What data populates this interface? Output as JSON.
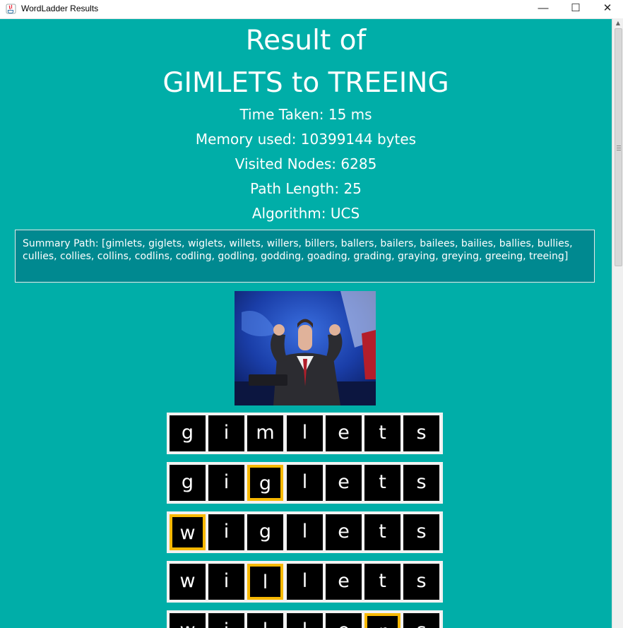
{
  "window": {
    "title": "WordLadder Results",
    "controls": {
      "minimize": "—",
      "maximize": "☐",
      "close": "✕"
    }
  },
  "result": {
    "heading_line1": "Result of",
    "heading_line2": "GIMLETS to TREEING",
    "time_taken": "Time Taken: 15 ms",
    "memory_used": "Memory used: 10399144 bytes",
    "visited_nodes": "Visited Nodes: 6285",
    "path_length": "Path Length: 25",
    "algorithm": "Algorithm: UCS",
    "summary_path": "Summary Path: [gimlets, giglets, wiglets, willets, willers, billers, ballers, bailers, bailees, bailies, ballies, bullies, cullies, collies, collins, codlins, codling, godling, godding, goading, grading, graying, greying, greeing, treeing]"
  },
  "ladder": [
    {
      "letters": [
        "g",
        "i",
        "m",
        "l",
        "e",
        "t",
        "s"
      ],
      "changed": -1
    },
    {
      "letters": [
        "g",
        "i",
        "g",
        "l",
        "e",
        "t",
        "s"
      ],
      "changed": 2
    },
    {
      "letters": [
        "w",
        "i",
        "g",
        "l",
        "e",
        "t",
        "s"
      ],
      "changed": 0
    },
    {
      "letters": [
        "w",
        "i",
        "l",
        "l",
        "e",
        "t",
        "s"
      ],
      "changed": 2
    },
    {
      "letters": [
        "w",
        "i",
        "l",
        "l",
        "e",
        "r",
        "s"
      ],
      "changed": 5
    }
  ],
  "colors": {
    "background": "#00aea8",
    "summary_box": "#008990",
    "tile": "#000000",
    "highlight": "#f7b801"
  }
}
